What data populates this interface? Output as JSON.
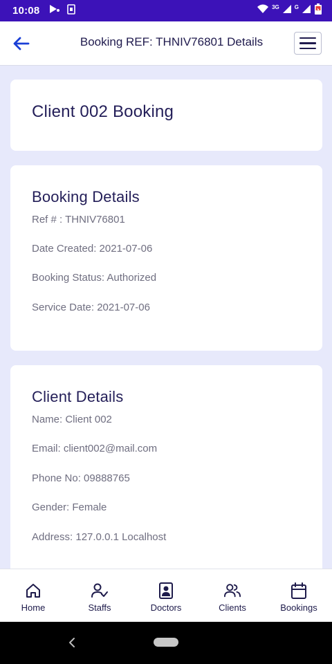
{
  "status_bar": {
    "time": "10:08",
    "network_label_1": "3G",
    "network_label_2": "G"
  },
  "app_bar": {
    "title": "Booking REF: THNIV76801 Details"
  },
  "header_card": {
    "title": "Client 002 Booking"
  },
  "booking_details": {
    "title": "Booking Details",
    "ref": "Ref # : THNIV76801",
    "date_created": "Date Created: 2021-07-06",
    "status": "Booking Status: Authorized",
    "service_date": "Service Date: 2021-07-06"
  },
  "client_details": {
    "title": "Client Details",
    "name": "Name: Client 002",
    "email": "Email: client002@mail.com",
    "phone": "Phone No: 09888765",
    "gender": "Gender: Female",
    "address": "Address: 127.0.0.1 Localhost"
  },
  "bottom_nav": {
    "items": [
      {
        "label": "Home",
        "icon": "home-icon"
      },
      {
        "label": "Staffs",
        "icon": "user-check-icon"
      },
      {
        "label": "Doctors",
        "icon": "doctor-badge-icon"
      },
      {
        "label": "Clients",
        "icon": "users-icon"
      },
      {
        "label": "Bookings",
        "icon": "calendar-icon"
      }
    ]
  },
  "colors": {
    "status_bar": "#3c12b8",
    "accent": "#1a3fd6",
    "page_background": "#e7e9fb",
    "title_text": "#231e58",
    "body_text": "#6f6e80"
  }
}
